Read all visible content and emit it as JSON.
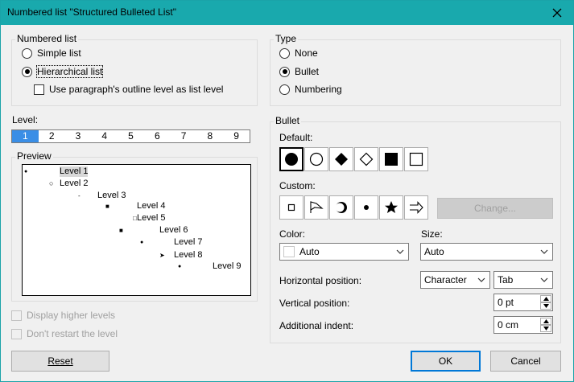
{
  "window": {
    "title": "Numbered list \"Structured Bulleted List\""
  },
  "numbered_list": {
    "label": "Numbered list",
    "simple": "Simple list",
    "hierarchical": "Hierarchical list",
    "selected": "hierarchical",
    "outline_check": "Use paragraph's outline level as list level"
  },
  "type": {
    "label": "Type",
    "none": "None",
    "bullet": "Bullet",
    "numbering": "Numbering",
    "selected": "bullet"
  },
  "level": {
    "label": "Level:",
    "items": [
      "1",
      "2",
      "3",
      "4",
      "5",
      "6",
      "7",
      "8",
      "9"
    ],
    "selected": "1"
  },
  "preview": {
    "label": "Preview",
    "lines": [
      {
        "bullet": "●",
        "text": "Level 1"
      },
      {
        "bullet": "○",
        "text": "Level 2"
      },
      {
        "bullet": "-",
        "text": "Level 3"
      },
      {
        "bullet": "■",
        "text": "Level 4"
      },
      {
        "bullet": "□",
        "text": "Level 5"
      },
      {
        "bullet": "■",
        "text": "Level 6"
      },
      {
        "bullet": "●",
        "text": "Level 7"
      },
      {
        "bullet": "➤",
        "text": "Level 8"
      },
      {
        "bullet": "●",
        "text": "Level 9"
      }
    ]
  },
  "bullet": {
    "label": "Bullet",
    "default_label": "Default:",
    "default_icons": [
      "filled-circle",
      "hollow-circle",
      "filled-diamond",
      "hollow-diamond",
      "filled-square",
      "hollow-square"
    ],
    "custom_label": "Custom:",
    "custom_icons": [
      "small-square",
      "flag",
      "crescent",
      "small-dot",
      "star",
      "arrow"
    ],
    "change_button": "Change...",
    "color_label": "Color:",
    "color_value": "Auto",
    "size_label": "Size:",
    "size_value": "Auto",
    "hpos_label": "Horizontal position:",
    "hpos_value": "Character",
    "hpos_tab": "Tab",
    "vpos_label": "Vertical position:",
    "vpos_value": "0 pt",
    "indent_label": "Additional indent:",
    "indent_value": "0 cm"
  },
  "options": {
    "display_higher": "Display higher levels",
    "dont_restart": "Don't restart the level"
  },
  "buttons": {
    "reset": "Reset",
    "ok": "OK",
    "cancel": "Cancel"
  },
  "colors": {
    "titlebar": "#19a9ad",
    "level_selected": "#3a8ee6",
    "ok_border": "#0078d7"
  }
}
